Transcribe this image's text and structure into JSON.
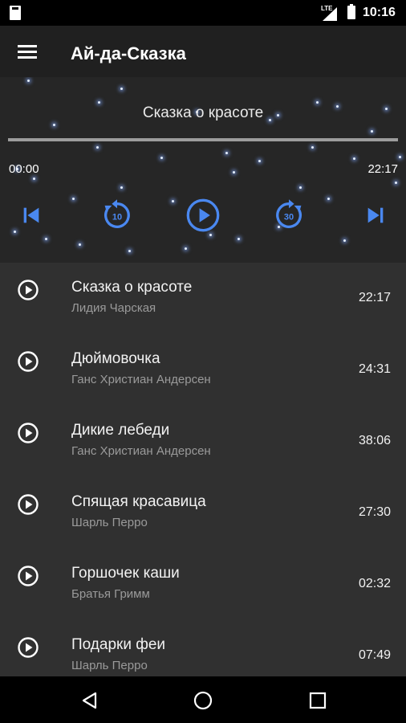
{
  "status_bar": {
    "network": "LTE",
    "time": "10:16"
  },
  "app_bar": {
    "title": "Ай-да-Сказка",
    "menu_icon": "hamburger-menu-icon"
  },
  "player": {
    "now_playing": "Сказка о красоте",
    "elapsed": "00:00",
    "duration": "22:17",
    "progress": 0,
    "controls": [
      "skip-previous-icon",
      "rewind-10-icon",
      "play-icon",
      "forward-30-icon",
      "skip-next-icon"
    ],
    "rewind_label": "10",
    "forward_label": "30",
    "accent_color": "#4a88f0"
  },
  "tracks": [
    {
      "title": "Сказка о красоте",
      "author": "Лидия Чарская",
      "duration": "22:17"
    },
    {
      "title": "Дюймовочка",
      "author": "Ганс Христиан Андерсен",
      "duration": "24:31"
    },
    {
      "title": "Дикие лебеди",
      "author": "Ганс Христиан Андерсен",
      "duration": "38:06"
    },
    {
      "title": "Спящая красавица",
      "author": "Шарль Перро",
      "duration": "27:30"
    },
    {
      "title": "Горшочек каши",
      "author": "Братья Гримм",
      "duration": "02:32"
    },
    {
      "title": "Подарки феи",
      "author": "Шарль Перро",
      "duration": "07:49"
    }
  ],
  "nav_bar": {
    "buttons": [
      "back-icon",
      "home-icon",
      "recents-icon"
    ]
  }
}
